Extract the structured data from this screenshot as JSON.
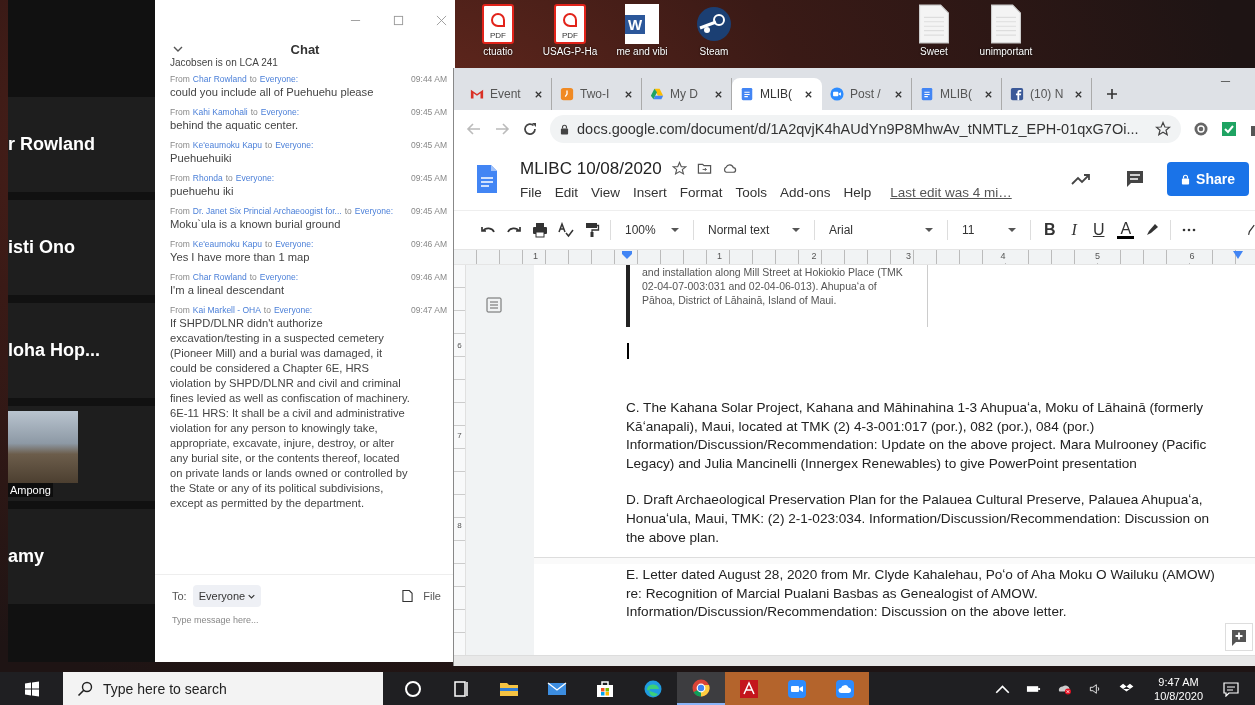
{
  "desktop_icons": [
    {
      "kind": "pdf",
      "badge": "PDF",
      "label": "ctuatio"
    },
    {
      "kind": "pdf",
      "badge": "PDF",
      "label": "USAG-P-Ha"
    },
    {
      "kind": "word",
      "badge": "W",
      "label": "me and vibi"
    },
    {
      "kind": "steam",
      "label": "Steam"
    },
    {
      "kind": "file",
      "label": "Sweet"
    },
    {
      "kind": "file",
      "label": "unimportant"
    }
  ],
  "zoom": {
    "participants": [
      {
        "kind": "name",
        "name": "r Rowland"
      },
      {
        "kind": "name",
        "name": "isti Ono"
      },
      {
        "kind": "name",
        "name": "loha Hop..."
      },
      {
        "kind": "video",
        "name": "Ampong"
      },
      {
        "kind": "name",
        "name": "amy"
      }
    ],
    "chat": {
      "title": "Chat",
      "partial_line": "Jacobsen is on LCA 241",
      "messages": [
        {
          "prefix": "From",
          "sender": "Char Rowland",
          "joiner": "to",
          "recipient": "Everyone:",
          "time": "09:44 AM",
          "text": "could you include all of Puehuehu please"
        },
        {
          "prefix": "From",
          "sender": "Kahi Kamohali",
          "joiner": "to",
          "recipient": "Everyone:",
          "time": "09:45 AM",
          "text": "behind the aquatic center."
        },
        {
          "prefix": "From",
          "sender": "Ke'eaumoku Kapu",
          "joiner": "to",
          "recipient": "Everyone:",
          "time": "09:45 AM",
          "text": "Puehuehuiki"
        },
        {
          "prefix": "From",
          "sender": "Rhonda",
          "joiner": "to",
          "recipient": "Everyone:",
          "time": "09:45 AM",
          "text": "puehuehu iki"
        },
        {
          "prefix": "From",
          "sender": "Dr. Janet Six Princial Archaeoogist for...",
          "joiner": "to",
          "recipient": "Everyone:",
          "time": "09:45 AM",
          "text": "Moku`ula is a known burial ground"
        },
        {
          "prefix": "From",
          "sender": "Ke'eaumoku Kapu",
          "joiner": "to",
          "recipient": "Everyone:",
          "time": "09:46 AM",
          "text": "Yes I have more than 1 map"
        },
        {
          "prefix": "From",
          "sender": "Char Rowland",
          "joiner": "to",
          "recipient": "Everyone:",
          "time": "09:46 AM",
          "text": "I'm a lineal descendant"
        },
        {
          "prefix": "From",
          "sender": "Kai Markell - OHA",
          "joiner": "to",
          "recipient": "Everyone:",
          "time": "09:47 AM",
          "text": "If SHPD/DLNR didn't authorize excavation/testing in a suspected cemetery (Pioneer Mill) and a burial was damaged, it could be considered a Chapter 6E, HRS violation by SHPD/DLNR and civil and criminal fines levied as well as confiscation of machinery. 6E-11 HRS: It shall be a civil and administrative violation for any person to knowingly take, appropriate, excavate, injure, destroy, or alter any burial site, or the contents thereof, located on private lands or lands owned or controlled by the State or any of its political subdivisions, except as permitted by the department."
        }
      ],
      "to_label": "To:",
      "recipient": "Everyone",
      "file_label": "File",
      "placeholder": "Type message here..."
    }
  },
  "browser": {
    "tabs": [
      {
        "kind": "gmail",
        "title": "Event",
        "selected": false
      },
      {
        "kind": "clock",
        "title": "Two-I",
        "selected": false
      },
      {
        "kind": "drive",
        "title": "My D",
        "selected": false
      },
      {
        "kind": "docs",
        "title": "MLIB(",
        "selected": true
      },
      {
        "kind": "video",
        "title": "Post /",
        "selected": false
      },
      {
        "kind": "docs",
        "title": "MLIB(",
        "selected": false
      },
      {
        "kind": "facebook",
        "title": "(10) N",
        "selected": false
      }
    ],
    "url": "docs.google.com/document/d/1A2qvjK4hAUdYn9P8MhwAv_tNMTLz_EPH-01qxG7Oi..."
  },
  "docs": {
    "title": "MLIBC 10/08/2020",
    "menus": [
      "File",
      "Edit",
      "View",
      "Insert",
      "Format",
      "Tools",
      "Add-ons",
      "Help"
    ],
    "last_edit": "Last edit was 4 mi…",
    "share": "Share",
    "zoom": "100%",
    "style": "Normal text",
    "font": "Arial",
    "size": "11",
    "format_buttons": [
      {
        "kind": "bold",
        "label": "B"
      },
      {
        "kind": "italic",
        "label": "I"
      },
      {
        "kind": "underline",
        "label": "U"
      },
      {
        "kind": "color",
        "label": "A"
      }
    ],
    "ruler": [
      "1",
      "1",
      "2",
      "3",
      "4",
      "5",
      "6"
    ],
    "vertical_ruler": [
      "6",
      "7",
      "8"
    ],
    "table_cell": "and installation along Mill Street at Hokiokio Place (TMK 02-04-07-003:031 and 02-04-06-013). Ahupuaʻa of Pāhoa, District of Lāhainā, Island of Maui.",
    "paragraphs": [
      {
        "page_break_before": false,
        "text": "C. The Kahana Solar Project, Kahana and Māhinahina 1-3 Ahupuaʻa, Moku of Lāhainā (formerly Kāʻanapali), Maui, located at TMK (2) 4-3-001:017 (por.), 082 (por.), 084 (por.) Information/Discussion/Recommendation: Update on the above project. Mara Mulrooney (Pacific Legacy) and Julia Mancinelli (Innergex Renewables) to give PowerPoint presentation"
      },
      {
        "page_break_before": false,
        "text": "D. Draft Archaeological Preservation Plan for the Palauea Cultural Preserve, Palauea Ahupuaʻa, Honuaʻula, Maui, TMK: (2) 2-1-023:034. Information/Discussion/Recommendation: Discussion on the above plan."
      },
      {
        "page_break_before": true,
        "text": "E. Letter dated August 28, 2020 from Mr. Clyde Kahalehau, Poʻo of Aha Moku O Wailuku (AMOW) re: Recognition of Marcial Pualani Basbas as Genealogist of AMOW. Information/Discussion/Recommendation: Discussion on the above letter."
      }
    ]
  },
  "taskbar": {
    "search_placeholder": "Type here to search",
    "apps": [
      {
        "kind": "cortana",
        "selected": false,
        "flashing": false
      },
      {
        "kind": "taskview",
        "selected": false,
        "flashing": false
      },
      {
        "kind": "explorer",
        "selected": false,
        "flashing": false
      },
      {
        "kind": "mail",
        "selected": false,
        "flashing": false
      },
      {
        "kind": "store",
        "selected": false,
        "flashing": false
      },
      {
        "kind": "edge",
        "selected": false,
        "flashing": false
      },
      {
        "kind": "chrome",
        "selected": true,
        "flashing": false
      },
      {
        "kind": "acrobat",
        "selected": false,
        "flashing": true
      },
      {
        "kind": "zoom",
        "selected": false,
        "flashing": true
      },
      {
        "kind": "cloud",
        "selected": false,
        "flashing": true
      }
    ],
    "time": "9:47 AM",
    "date": "10/8/2020"
  }
}
